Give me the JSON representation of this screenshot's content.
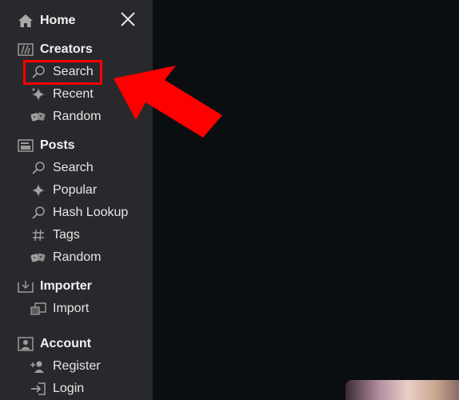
{
  "sidebar": {
    "home": {
      "label": "Home",
      "icon": "home-icon"
    },
    "close": {
      "icon": "close-icon"
    },
    "sections": [
      {
        "title": "Creators",
        "icon": "creators-icon",
        "items": [
          {
            "label": "Search",
            "icon": "search-icon"
          },
          {
            "label": "Recent",
            "icon": "sparkle-icon"
          },
          {
            "label": "Random",
            "icon": "dice-icon"
          }
        ]
      },
      {
        "title": "Posts",
        "icon": "posts-icon",
        "items": [
          {
            "label": "Search",
            "icon": "search-icon"
          },
          {
            "label": "Popular",
            "icon": "sparkle-icon"
          },
          {
            "label": "Hash Lookup",
            "icon": "search-icon"
          },
          {
            "label": "Tags",
            "icon": "hash-icon"
          },
          {
            "label": "Random",
            "icon": "dice-icon"
          }
        ]
      },
      {
        "title": "Importer",
        "icon": "importer-icon",
        "items": [
          {
            "label": "Import",
            "icon": "import-icon"
          }
        ]
      },
      {
        "title": "Account",
        "icon": "account-icon",
        "items": [
          {
            "label": "Register",
            "icon": "register-icon"
          },
          {
            "label": "Login",
            "icon": "login-icon"
          }
        ]
      }
    ]
  },
  "annotation": {
    "highlight_color": "#ff0000",
    "arrow_color": "#ff0000"
  },
  "colors": {
    "sidebar_bg": "#28292c",
    "main_bg": "#0b0e11",
    "text": "#e6e6e6",
    "icon": "#9a9a9a"
  }
}
